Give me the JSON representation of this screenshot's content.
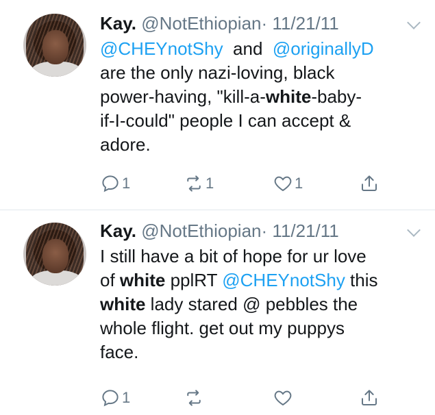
{
  "tweets": [
    {
      "display_name": "Kay.",
      "handle": "@NotEthiopian",
      "separator": "·",
      "date": "11/21/11",
      "text_parts": [
        {
          "t": "@CHEYnotShy",
          "k": "mention"
        },
        {
          "t": "  and  ",
          "k": ""
        },
        {
          "t": "@originallyD",
          "k": "mention"
        },
        {
          "t": "\nare the only nazi-loving, black\npower-having, \"kill-a-",
          "k": ""
        },
        {
          "t": "white",
          "k": "hl"
        },
        {
          "t": "-baby-\nif-I-could\" people I can accept &\nadore.",
          "k": ""
        }
      ],
      "reply_count": "1",
      "retweet_count": "1",
      "like_count": "1"
    },
    {
      "display_name": "Kay.",
      "handle": "@NotEthiopian",
      "separator": "·",
      "date": "11/21/11",
      "text_parts": [
        {
          "t": "I still have a bit of hope for ur love\nof ",
          "k": ""
        },
        {
          "t": "white",
          "k": "hl"
        },
        {
          "t": " pplRT ",
          "k": ""
        },
        {
          "t": "@CHEYnotShy",
          "k": "mention"
        },
        {
          "t": " this\n",
          "k": ""
        },
        {
          "t": "white",
          "k": "hl"
        },
        {
          "t": " lady stared @ pebbles the\nwhole flight. get out my puppys\nface.",
          "k": ""
        }
      ],
      "reply_count": "1",
      "retweet_count": "",
      "like_count": ""
    }
  ],
  "icons": {
    "reply": "reply-icon",
    "retweet": "retweet-icon",
    "like": "heart-icon",
    "share": "share-icon",
    "menu": "chevron-down-icon"
  },
  "colors": {
    "mention": "#1da1f2",
    "muted": "#657786",
    "divider": "#e1e8ed"
  }
}
